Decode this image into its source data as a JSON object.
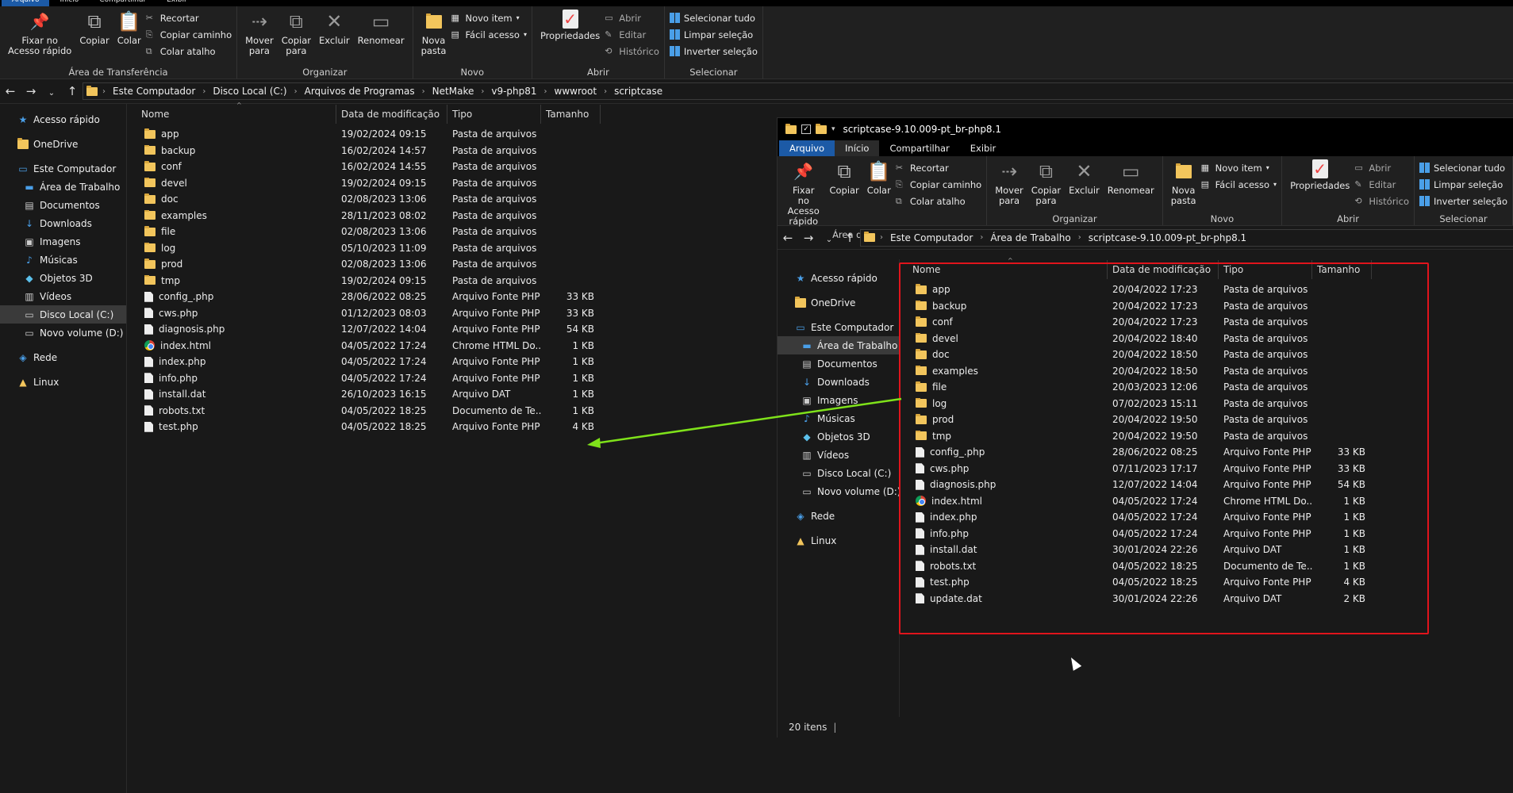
{
  "main": {
    "tabs": [
      "Arquivo",
      "Início",
      "Compartilhar",
      "Exibir"
    ],
    "ribbon": {
      "clipboard": {
        "pin": "Fixar no\nAcesso rápido",
        "copy": "Copiar",
        "paste": "Colar",
        "cut": "Recortar",
        "copy_path": "Copiar caminho",
        "paste_shortcut": "Colar atalho",
        "label": "Área de Transferência"
      },
      "organize": {
        "move": "Mover\npara",
        "copyto": "Copiar\npara",
        "delete": "Excluir",
        "rename": "Renomear",
        "label": "Organizar"
      },
      "new": {
        "folder": "Nova\npasta",
        "item": "Novo item",
        "easy": "Fácil acesso",
        "label": "Novo"
      },
      "open": {
        "props": "Propriedades",
        "open": "Abrir",
        "edit": "Editar",
        "history": "Histórico",
        "label": "Abrir"
      },
      "select": {
        "all": "Selecionar tudo",
        "none": "Limpar seleção",
        "invert": "Inverter seleção",
        "label": "Selecionar"
      }
    },
    "breadcrumb": [
      "Este Computador",
      "Disco Local (C:)",
      "Arquivos de Programas",
      "NetMake",
      "v9-php81",
      "wwwroot",
      "scriptcase"
    ],
    "nav": [
      {
        "label": "Acesso rápido",
        "icon": "star-icon",
        "indent": 0
      },
      {
        "label": "OneDrive",
        "icon": "folder-icon",
        "indent": 0
      },
      {
        "label": "Este Computador",
        "icon": "computer-icon",
        "indent": 0
      },
      {
        "label": "Área de Trabalho",
        "icon": "desktop-icon",
        "indent": 1
      },
      {
        "label": "Documentos",
        "icon": "documents-icon",
        "indent": 1
      },
      {
        "label": "Downloads",
        "icon": "download-icon",
        "indent": 1
      },
      {
        "label": "Imagens",
        "icon": "images-icon",
        "indent": 1
      },
      {
        "label": "Músicas",
        "icon": "music-icon",
        "indent": 1
      },
      {
        "label": "Objetos 3D",
        "icon": "cube-icon",
        "indent": 1
      },
      {
        "label": "Vídeos",
        "icon": "video-icon",
        "indent": 1
      },
      {
        "label": "Disco Local (C:)",
        "icon": "drive-icon",
        "indent": 1,
        "selected": true
      },
      {
        "label": "Novo volume (D:)",
        "icon": "drive-icon",
        "indent": 1
      },
      {
        "label": "Rede",
        "icon": "network-icon",
        "indent": 0
      },
      {
        "label": "Linux",
        "icon": "linux-icon",
        "indent": 0
      }
    ],
    "columns": [
      "Nome",
      "Data de modificação",
      "Tipo",
      "Tamanho"
    ],
    "files": [
      {
        "name": "app",
        "date": "19/02/2024 09:15",
        "type": "Pasta de arquivos",
        "size": "",
        "kind": "folder"
      },
      {
        "name": "backup",
        "date": "16/02/2024 14:57",
        "type": "Pasta de arquivos",
        "size": "",
        "kind": "folder"
      },
      {
        "name": "conf",
        "date": "16/02/2024 14:55",
        "type": "Pasta de arquivos",
        "size": "",
        "kind": "folder"
      },
      {
        "name": "devel",
        "date": "19/02/2024 09:15",
        "type": "Pasta de arquivos",
        "size": "",
        "kind": "folder"
      },
      {
        "name": "doc",
        "date": "02/08/2023 13:06",
        "type": "Pasta de arquivos",
        "size": "",
        "kind": "folder"
      },
      {
        "name": "examples",
        "date": "28/11/2023 08:02",
        "type": "Pasta de arquivos",
        "size": "",
        "kind": "folder"
      },
      {
        "name": "file",
        "date": "02/08/2023 13:06",
        "type": "Pasta de arquivos",
        "size": "",
        "kind": "folder"
      },
      {
        "name": "log",
        "date": "05/10/2023 11:09",
        "type": "Pasta de arquivos",
        "size": "",
        "kind": "folder"
      },
      {
        "name": "prod",
        "date": "02/08/2023 13:06",
        "type": "Pasta de arquivos",
        "size": "",
        "kind": "folder"
      },
      {
        "name": "tmp",
        "date": "19/02/2024 09:15",
        "type": "Pasta de arquivos",
        "size": "",
        "kind": "folder"
      },
      {
        "name": "config_.php",
        "date": "28/06/2022 08:25",
        "type": "Arquivo Fonte PHP",
        "size": "33 KB",
        "kind": "file"
      },
      {
        "name": "cws.php",
        "date": "01/12/2023 08:03",
        "type": "Arquivo Fonte PHP",
        "size": "33 KB",
        "kind": "file"
      },
      {
        "name": "diagnosis.php",
        "date": "12/07/2022 14:04",
        "type": "Arquivo Fonte PHP",
        "size": "54 KB",
        "kind": "file"
      },
      {
        "name": "index.html",
        "date": "04/05/2022 17:24",
        "type": "Chrome HTML Do...",
        "size": "1 KB",
        "kind": "chrome"
      },
      {
        "name": "index.php",
        "date": "04/05/2022 17:24",
        "type": "Arquivo Fonte PHP",
        "size": "1 KB",
        "kind": "file"
      },
      {
        "name": "info.php",
        "date": "04/05/2022 17:24",
        "type": "Arquivo Fonte PHP",
        "size": "1 KB",
        "kind": "file"
      },
      {
        "name": "install.dat",
        "date": "26/10/2023 16:15",
        "type": "Arquivo DAT",
        "size": "1 KB",
        "kind": "file"
      },
      {
        "name": "robots.txt",
        "date": "04/05/2022 18:25",
        "type": "Documento de Te...",
        "size": "1 KB",
        "kind": "file"
      },
      {
        "name": "test.php",
        "date": "04/05/2022 18:25",
        "type": "Arquivo Fonte PHP",
        "size": "4 KB",
        "kind": "file"
      }
    ]
  },
  "second": {
    "title": "scriptcase-9.10.009-pt_br-php8.1",
    "breadcrumb": [
      "Este Computador",
      "Área de Trabalho",
      "scriptcase-9.10.009-pt_br-php8.1"
    ],
    "nav": [
      {
        "label": "Acesso rápido",
        "icon": "star-icon",
        "indent": 0
      },
      {
        "label": "OneDrive",
        "icon": "folder-icon",
        "indent": 0
      },
      {
        "label": "Este Computador",
        "icon": "computer-icon",
        "indent": 0
      },
      {
        "label": "Área de Trabalho",
        "icon": "desktop-icon",
        "indent": 1,
        "selected": true
      },
      {
        "label": "Documentos",
        "icon": "documents-icon",
        "indent": 1
      },
      {
        "label": "Downloads",
        "icon": "download-icon",
        "indent": 1
      },
      {
        "label": "Imagens",
        "icon": "images-icon",
        "indent": 1
      },
      {
        "label": "Músicas",
        "icon": "music-icon",
        "indent": 1
      },
      {
        "label": "Objetos 3D",
        "icon": "cube-icon",
        "indent": 1
      },
      {
        "label": "Vídeos",
        "icon": "video-icon",
        "indent": 1
      },
      {
        "label": "Disco Local (C:)",
        "icon": "drive-icon",
        "indent": 1
      },
      {
        "label": "Novo volume (D:)",
        "icon": "drive-icon",
        "indent": 1
      },
      {
        "label": "Rede",
        "icon": "network-icon",
        "indent": 0
      },
      {
        "label": "Linux",
        "icon": "linux-icon",
        "indent": 0
      }
    ],
    "files": [
      {
        "name": "app",
        "date": "20/04/2022 17:23",
        "type": "Pasta de arquivos",
        "size": "",
        "kind": "folder"
      },
      {
        "name": "backup",
        "date": "20/04/2022 17:23",
        "type": "Pasta de arquivos",
        "size": "",
        "kind": "folder"
      },
      {
        "name": "conf",
        "date": "20/04/2022 17:23",
        "type": "Pasta de arquivos",
        "size": "",
        "kind": "folder"
      },
      {
        "name": "devel",
        "date": "20/04/2022 18:40",
        "type": "Pasta de arquivos",
        "size": "",
        "kind": "folder"
      },
      {
        "name": "doc",
        "date": "20/04/2022 18:50",
        "type": "Pasta de arquivos",
        "size": "",
        "kind": "folder"
      },
      {
        "name": "examples",
        "date": "20/04/2022 18:50",
        "type": "Pasta de arquivos",
        "size": "",
        "kind": "folder"
      },
      {
        "name": "file",
        "date": "20/03/2023 12:06",
        "type": "Pasta de arquivos",
        "size": "",
        "kind": "folder"
      },
      {
        "name": "log",
        "date": "07/02/2023 15:11",
        "type": "Pasta de arquivos",
        "size": "",
        "kind": "folder"
      },
      {
        "name": "prod",
        "date": "20/04/2022 19:50",
        "type": "Pasta de arquivos",
        "size": "",
        "kind": "folder"
      },
      {
        "name": "tmp",
        "date": "20/04/2022 19:50",
        "type": "Pasta de arquivos",
        "size": "",
        "kind": "folder"
      },
      {
        "name": "config_.php",
        "date": "28/06/2022 08:25",
        "type": "Arquivo Fonte PHP",
        "size": "33 KB",
        "kind": "file"
      },
      {
        "name": "cws.php",
        "date": "07/11/2023 17:17",
        "type": "Arquivo Fonte PHP",
        "size": "33 KB",
        "kind": "file"
      },
      {
        "name": "diagnosis.php",
        "date": "12/07/2022 14:04",
        "type": "Arquivo Fonte PHP",
        "size": "54 KB",
        "kind": "file"
      },
      {
        "name": "index.html",
        "date": "04/05/2022 17:24",
        "type": "Chrome HTML Do...",
        "size": "1 KB",
        "kind": "chrome"
      },
      {
        "name": "index.php",
        "date": "04/05/2022 17:24",
        "type": "Arquivo Fonte PHP",
        "size": "1 KB",
        "kind": "file"
      },
      {
        "name": "info.php",
        "date": "04/05/2022 17:24",
        "type": "Arquivo Fonte PHP",
        "size": "1 KB",
        "kind": "file"
      },
      {
        "name": "install.dat",
        "date": "30/01/2024 22:26",
        "type": "Arquivo DAT",
        "size": "1 KB",
        "kind": "file"
      },
      {
        "name": "robots.txt",
        "date": "04/05/2022 18:25",
        "type": "Documento de Te...",
        "size": "1 KB",
        "kind": "file"
      },
      {
        "name": "test.php",
        "date": "04/05/2022 18:25",
        "type": "Arquivo Fonte PHP",
        "size": "4 KB",
        "kind": "file"
      },
      {
        "name": "update.dat",
        "date": "30/01/2024 22:26",
        "type": "Arquivo DAT",
        "size": "2 KB",
        "kind": "file"
      }
    ],
    "status": "20 itens"
  },
  "colors": {
    "accent": "#1c5aa6",
    "highlight": "#e0141c",
    "arrow": "#7fe21a",
    "folder": "#f2c55c"
  }
}
